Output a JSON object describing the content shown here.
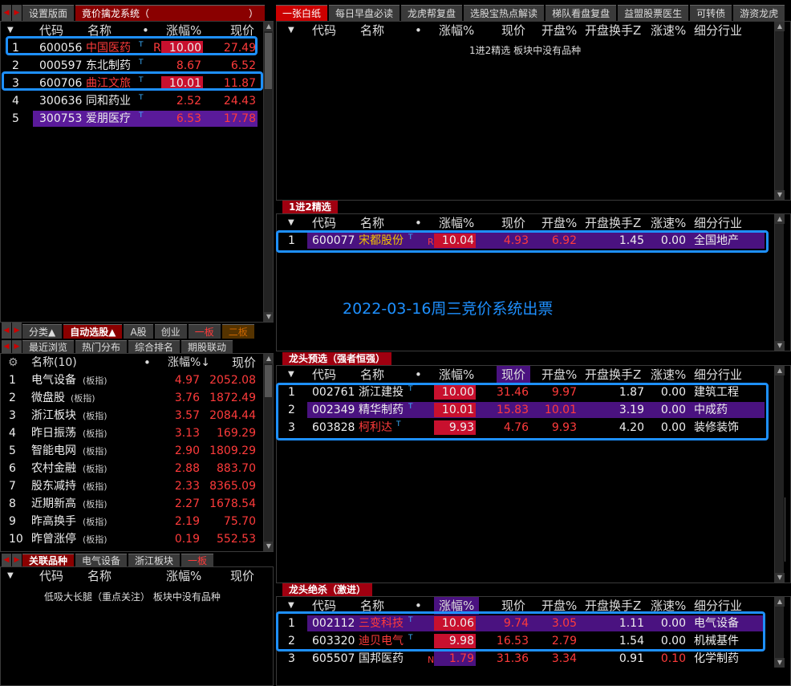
{
  "left_tabs": [
    "设置版面",
    "竟价擒龙系统（",
    "）"
  ],
  "top_tabs": [
    "一张白纸",
    "每日早盘必读",
    "龙虎帮复盘",
    "选股宝热点解读",
    "梯队看盘复盘",
    "益盟股票医生",
    "可转债",
    "游资龙虎"
  ],
  "lt": {
    "headers": [
      "代码",
      "名称",
      "•",
      "涨幅%",
      "现价"
    ],
    "rows": [
      {
        "n": "1",
        "code": "600056",
        "name": "中国医药",
        "flag": "R",
        "chg": "10.00",
        "price": "27.49"
      },
      {
        "n": "2",
        "code": "000597",
        "name": "东北制药",
        "flag": "",
        "chg": "8.67",
        "price": "6.52"
      },
      {
        "n": "3",
        "code": "600706",
        "name": "曲江文旅",
        "flag": "",
        "chg": "10.01",
        "price": "11.87"
      },
      {
        "n": "4",
        "code": "300636",
        "name": "同和药业",
        "flag": "",
        "chg": "2.52",
        "price": "24.43"
      },
      {
        "n": "5",
        "code": "300753",
        "name": "爱朋医疗",
        "flag": "",
        "chg": "6.53",
        "price": "17.78"
      }
    ]
  },
  "mid_tabs1": [
    "分类▲",
    "自动选股▲",
    "A股",
    "创业",
    "一板",
    "二板"
  ],
  "mid_tabs2": [
    "最近浏览",
    "热门分布",
    "综合排名",
    "期股联动"
  ],
  "lm": {
    "headers": [
      "名称(10)",
      "涨幅%↓",
      "现价"
    ],
    "rows": [
      {
        "n": "1",
        "name": "电气设备",
        "tag": "(板指)",
        "chg": "4.97",
        "price": "2052.08"
      },
      {
        "n": "2",
        "name": "微盘股",
        "tag": "(板指)",
        "chg": "3.76",
        "price": "1872.49"
      },
      {
        "n": "3",
        "name": "浙江板块",
        "tag": "(板指)",
        "chg": "3.57",
        "price": "2084.44"
      },
      {
        "n": "4",
        "name": "昨日振荡",
        "tag": "(板指)",
        "chg": "3.13",
        "price": "169.29"
      },
      {
        "n": "5",
        "name": "智能电网",
        "tag": "(板指)",
        "chg": "2.90",
        "price": "1809.29"
      },
      {
        "n": "6",
        "name": "农村金融",
        "tag": "(板指)",
        "chg": "2.88",
        "price": "883.70"
      },
      {
        "n": "7",
        "name": "股东减持",
        "tag": "(板指)",
        "chg": "2.33",
        "price": "8365.09"
      },
      {
        "n": "8",
        "name": "近期新高",
        "tag": "(板指)",
        "chg": "2.27",
        "price": "1678.54"
      },
      {
        "n": "9",
        "name": "昨高换手",
        "tag": "(板指)",
        "chg": "2.19",
        "price": "75.70"
      },
      {
        "n": "10",
        "name": "昨曾涨停",
        "tag": "(板指)",
        "chg": "0.19",
        "price": "552.53"
      }
    ]
  },
  "bottom_tabs": [
    "关联品种",
    "电气设备",
    "浙江板块",
    "一板"
  ],
  "lb": {
    "headers": [
      "代码",
      "名称",
      "涨幅%",
      "现价"
    ],
    "msg": "低吸大长腿（重点关注） 板块中没有品种"
  },
  "rheaders": [
    "代码",
    "名称",
    "•",
    "涨幅%",
    "现价",
    "开盘%",
    "开盘换手Z",
    "涨速%",
    "细分行业"
  ],
  "r1": {
    "msg": "1进2精选 板块中没有品种"
  },
  "r2": {
    "label": "1进2精选",
    "rows": [
      {
        "n": "1",
        "code": "600077",
        "name": "宋都股份",
        "flag": "R",
        "chg": "10.04",
        "price": "4.93",
        "open": "6.92",
        "turn": "1.45",
        "speed": "0.00",
        "ind": "全国地产"
      }
    ],
    "banner": "2022-03-16周三竞价系统出票"
  },
  "r3": {
    "label": "龙头预选（强者恒强）",
    "rows": [
      {
        "n": "1",
        "code": "002761",
        "name": "浙江建投",
        "flag": "",
        "chg": "10.00",
        "price": "31.46",
        "open": "9.97",
        "turn": "1.87",
        "speed": "0.00",
        "ind": "建筑工程"
      },
      {
        "n": "2",
        "code": "002349",
        "name": "精华制药",
        "flag": "",
        "chg": "10.01",
        "price": "15.83",
        "open": "10.01",
        "turn": "3.19",
        "speed": "0.00",
        "ind": "中成药"
      },
      {
        "n": "3",
        "code": "603828",
        "name": "柯利达",
        "flag": "",
        "chg": "9.93",
        "price": "4.76",
        "open": "9.93",
        "turn": "4.20",
        "speed": "0.00",
        "ind": "装修装饰"
      }
    ]
  },
  "r4": {
    "label": "龙头绝杀（激进）",
    "rows": [
      {
        "n": "1",
        "code": "002112",
        "name": "三变科技",
        "flag": "",
        "chg": "10.06",
        "price": "9.74",
        "open": "3.05",
        "turn": "1.11",
        "speed": "0.00",
        "ind": "电气设备"
      },
      {
        "n": "2",
        "code": "603320",
        "name": "迪贝电气",
        "flag": "",
        "chg": "9.98",
        "price": "16.53",
        "open": "2.79",
        "turn": "1.54",
        "speed": "0.00",
        "ind": "机械基件"
      },
      {
        "n": "3",
        "code": "605507",
        "name": "国邦医药",
        "flag": "N",
        "chg": "1.79",
        "price": "31.36",
        "open": "3.34",
        "turn": "0.91",
        "speed": "0.10",
        "ind": "化学制药"
      }
    ]
  },
  "t_mark": "T",
  "gear_icon": "gear-icon",
  "colors": {
    "red": "#c8102e",
    "purple": "#4a1280",
    "blue": "#1e90ff"
  }
}
